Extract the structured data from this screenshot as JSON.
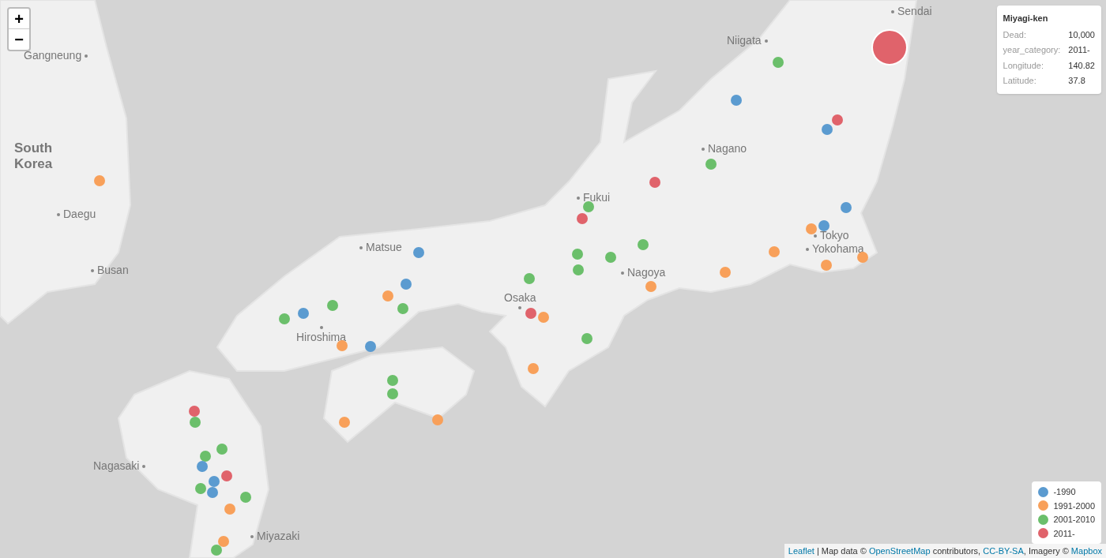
{
  "zoom_controls": [
    {
      "label": "+"
    },
    {
      "label": "−"
    }
  ],
  "place_labels": [
    {
      "text": "Sendai",
      "kind": "city"
    },
    {
      "text": "Niigata",
      "kind": "city"
    },
    {
      "text": "Nagano",
      "kind": "city"
    },
    {
      "text": "Fukui",
      "kind": "city"
    },
    {
      "text": "Tokyo",
      "kind": "city"
    },
    {
      "text": "Yokohama",
      "kind": "city"
    },
    {
      "text": "Nagoya",
      "kind": "city"
    },
    {
      "text": "Osaka",
      "kind": "city"
    },
    {
      "text": "Matsue",
      "kind": "city"
    },
    {
      "text": "Hiroshima",
      "kind": "city"
    },
    {
      "text": "Gangneung",
      "kind": "city"
    },
    {
      "text": "Daegu",
      "kind": "city"
    },
    {
      "text": "Busan",
      "kind": "city"
    },
    {
      "text": "South Korea",
      "kind": "country"
    },
    {
      "text": "Nagasaki",
      "kind": "city"
    },
    {
      "text": "Miyazaki",
      "kind": "city"
    }
  ],
  "markers": [
    {
      "color": "#e0636b",
      "selected": true
    },
    {
      "color": "#6bbf6b",
      "selected": false
    },
    {
      "color": "#5b9bd0",
      "selected": false
    },
    {
      "color": "#e0636b",
      "selected": false
    },
    {
      "color": "#5b9bd0",
      "selected": false
    },
    {
      "color": "#6bbf6b",
      "selected": false
    },
    {
      "color": "#e0636b",
      "selected": false
    },
    {
      "color": "#f8a05a",
      "selected": false
    },
    {
      "color": "#5b9bd0",
      "selected": false
    },
    {
      "color": "#6bbf6b",
      "selected": false
    },
    {
      "color": "#e0636b",
      "selected": false
    },
    {
      "color": "#f8a05a",
      "selected": false
    },
    {
      "color": "#5b9bd0",
      "selected": false
    },
    {
      "color": "#5b9bd0",
      "selected": false
    },
    {
      "color": "#6bbf6b",
      "selected": false
    },
    {
      "color": "#f8a05a",
      "selected": false
    },
    {
      "color": "#f8a05a",
      "selected": false
    },
    {
      "color": "#6bbf6b",
      "selected": false
    },
    {
      "color": "#6bbf6b",
      "selected": false
    },
    {
      "color": "#6bbf6b",
      "selected": false
    },
    {
      "color": "#f8a05a",
      "selected": false
    },
    {
      "color": "#f8a05a",
      "selected": false
    },
    {
      "color": "#5b9bd0",
      "selected": false
    },
    {
      "color": "#6bbf6b",
      "selected": false
    },
    {
      "color": "#f8a05a",
      "selected": false
    },
    {
      "color": "#f8a05a",
      "selected": false
    },
    {
      "color": "#6bbf6b",
      "selected": false
    },
    {
      "color": "#6bbf6b",
      "selected": false
    },
    {
      "color": "#5b9bd0",
      "selected": false
    },
    {
      "color": "#6bbf6b",
      "selected": false
    },
    {
      "color": "#e0636b",
      "selected": false
    },
    {
      "color": "#f8a05a",
      "selected": false
    },
    {
      "color": "#f8a05a",
      "selected": false
    },
    {
      "color": "#5b9bd0",
      "selected": false
    },
    {
      "color": "#6bbf6b",
      "selected": false
    },
    {
      "color": "#f8a05a",
      "selected": false
    },
    {
      "color": "#6bbf6b",
      "selected": false
    },
    {
      "color": "#6bbf6b",
      "selected": false
    },
    {
      "color": "#f8a05a",
      "selected": false
    },
    {
      "color": "#f8a05a",
      "selected": false
    },
    {
      "color": "#e0636b",
      "selected": false
    },
    {
      "color": "#6bbf6b",
      "selected": false
    },
    {
      "color": "#6bbf6b",
      "selected": false
    },
    {
      "color": "#6bbf6b",
      "selected": false
    },
    {
      "color": "#5b9bd0",
      "selected": false
    },
    {
      "color": "#5b9bd0",
      "selected": false
    },
    {
      "color": "#e0636b",
      "selected": false
    },
    {
      "color": "#6bbf6b",
      "selected": false
    },
    {
      "color": "#5b9bd0",
      "selected": false
    },
    {
      "color": "#6bbf6b",
      "selected": false
    },
    {
      "color": "#f8a05a",
      "selected": false
    },
    {
      "color": "#f8a05a",
      "selected": false
    },
    {
      "color": "#6bbf6b",
      "selected": false
    }
  ],
  "info_panel": {
    "title": "Miyagi-ken",
    "rows": [
      {
        "label": "Dead:",
        "value": "10,000"
      },
      {
        "label": "year_category:",
        "value": "2011-"
      },
      {
        "label": "Longitude:",
        "value": "140.82"
      },
      {
        "label": "Latitude:",
        "value": "37.8"
      }
    ]
  },
  "legend": [
    {
      "label": "-1990",
      "color": "#5b9bd0"
    },
    {
      "label": "1991-2000",
      "color": "#f8a05a"
    },
    {
      "label": "2001-2010",
      "color": "#6bbf6b"
    },
    {
      "label": "2011-",
      "color": "#e0636b"
    }
  ],
  "attribution": [
    {
      "text": "Leaflet",
      "kind": "link"
    },
    {
      "text": " | Map data © ",
      "kind": "text"
    },
    {
      "text": "OpenStreetMap",
      "kind": "link"
    },
    {
      "text": " contributors, ",
      "kind": "text"
    },
    {
      "text": "CC-BY-SA",
      "kind": "link"
    },
    {
      "text": ", Imagery © ",
      "kind": "text"
    },
    {
      "text": "Mapbox",
      "kind": "link"
    }
  ]
}
